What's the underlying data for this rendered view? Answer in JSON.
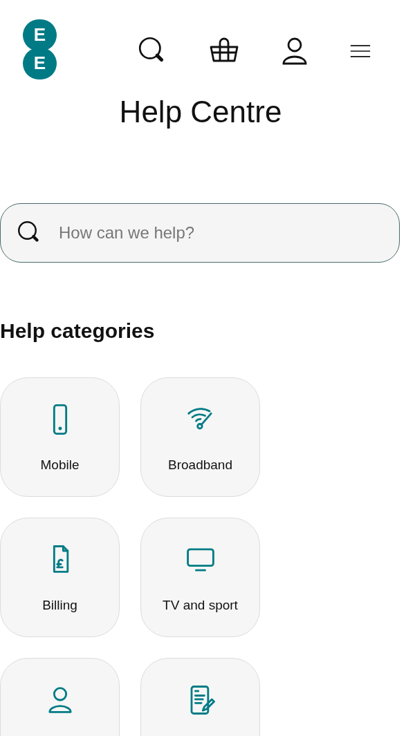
{
  "logo": {
    "letters": [
      "E",
      "E"
    ]
  },
  "title": "Help Centre",
  "search": {
    "placeholder": "How can we help?"
  },
  "categories_heading": "Help categories",
  "categories": [
    {
      "kind": "phone",
      "label": "Mobile"
    },
    {
      "kind": "wifi",
      "label": "Broadband"
    },
    {
      "kind": "bill",
      "label": "Billing"
    },
    {
      "kind": "tv",
      "label": "TV and sport"
    },
    {
      "kind": "person"
    },
    {
      "kind": "document"
    }
  ]
}
